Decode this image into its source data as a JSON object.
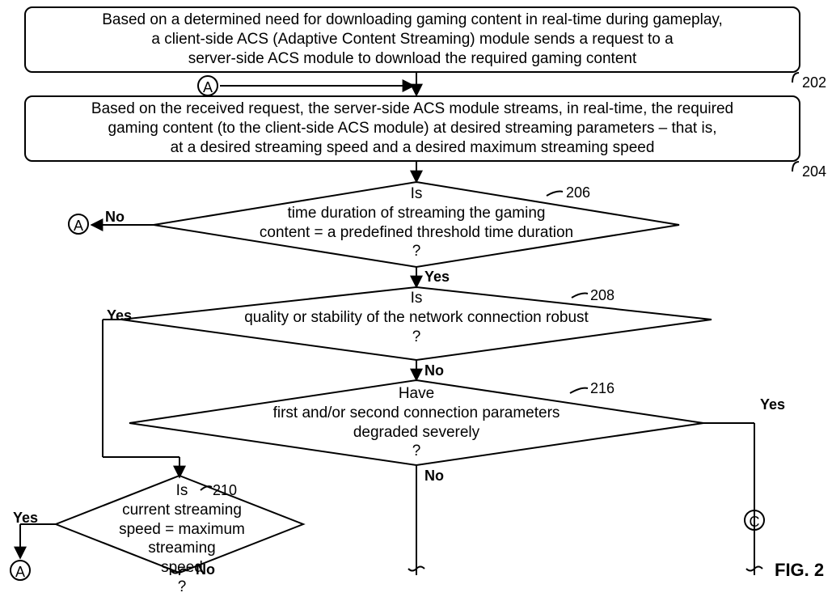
{
  "proc": {
    "b202": "Based on a determined need for downloading gaming content in real-time during gameplay,\na client-side ACS (Adaptive Content Streaming) module sends a request to a\nserver-side ACS module to download the required gaming content",
    "b204": "Based on the received request, the server-side ACS module streams, in real-time, the required\ngaming content (to the client-side ACS module) at desired streaming parameters – that is,\nat a desired streaming speed and a desired maximum streaming speed"
  },
  "dec": {
    "d206": "Is\ntime duration of streaming the gaming\ncontent = a predefined threshold time duration\n?",
    "d208": "Is\nquality or stability of the network connection robust\n?",
    "d216": "Have\nfirst and/or second connection parameters\ndegraded severely\n?",
    "d210": "Is\ncurrent streaming\nspeed = maximum streaming\nspeed\n?"
  },
  "labels": {
    "no": "No",
    "yes": "Yes"
  },
  "conn": {
    "A": "A",
    "C": "C"
  },
  "refs": {
    "r202": "202",
    "r204": "204",
    "r206": "206",
    "r208": "208",
    "r216": "216",
    "r210": "210"
  },
  "figure": "FIG. 2"
}
